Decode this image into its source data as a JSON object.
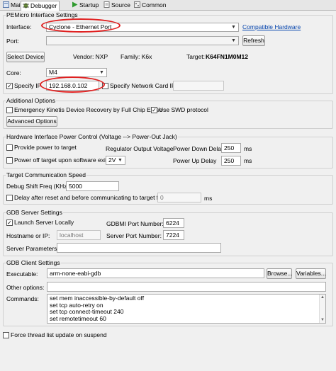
{
  "tabs": [
    {
      "label": "Main",
      "icon": "main-tab-icon"
    },
    {
      "label": "Debugger",
      "icon": "debugger-tab-icon"
    },
    {
      "label": "Startup",
      "icon": "startup-tab-icon"
    },
    {
      "label": "Source",
      "icon": "source-tab-icon"
    },
    {
      "label": "Common",
      "icon": "common-tab-icon"
    }
  ],
  "pemicro": {
    "title": "PEMicro Interface Settings",
    "interface_label": "Interface:",
    "interface_value": "Cyclone - Ethernet Port",
    "compatible_hardware": "Compatible Hardware",
    "port_label": "Port:",
    "port_value": "",
    "refresh": "Refresh",
    "select_device": "Select Device",
    "vendor": "Vendor: NXP",
    "family": "Family: K6x",
    "target_label": "Target:",
    "target_value": "K64FN1M0M12",
    "core_label": "Core:",
    "core_value": "M4",
    "specify_ip_label": "Specify IP",
    "specify_ip_checked": true,
    "ip_value": "192.168.0.102",
    "specify_nic_label": "Specify Network Card IP",
    "specify_nic_checked": false,
    "nic_value": ""
  },
  "additional": {
    "title": "Additional Options",
    "emergency_label": "Emergency Kinetis Device Recovery by Full Chip Erase",
    "emergency_checked": false,
    "swd_label": "Use SWD protocol",
    "swd_checked": true,
    "advanced_button": "Advanced Options"
  },
  "power": {
    "title": "Hardware Interface Power Control (Voltage --> Power-Out Jack)",
    "provide_label": "Provide power to target",
    "provide_checked": false,
    "regulator_label": "Regulator Output Voltage",
    "down_label": "Power Down Delay",
    "down_value": "250",
    "down_unit": "ms",
    "poweroff_label": "Power off target upon software exit",
    "poweroff_checked": false,
    "voltage_value": "2V",
    "up_label": "Power Up Delay",
    "up_value": "250",
    "up_unit": "ms"
  },
  "speed": {
    "title": "Target Communication Speed",
    "shift_label": "Debug Shift Freq (KHz)",
    "shift_value": "5000",
    "delay_label": "Delay after reset and before communicating to target for",
    "delay_checked": false,
    "delay_value": "0",
    "delay_unit": "ms"
  },
  "gdbserver": {
    "title": "GDB Server Settings",
    "launch_label": "Launch Server Locally",
    "launch_checked": true,
    "gdbmi_label": "GDBMI Port Number:",
    "gdbmi_value": "6224",
    "host_label": "Hostname or IP:",
    "host_value": "localhost",
    "server_port_label": "Server Port Number:",
    "server_port_value": "7224",
    "params_label": "Server Parameters:",
    "params_value": ""
  },
  "gdbclient": {
    "title": "GDB Client Settings",
    "exe_label": "Executable:",
    "exe_value": "arm-none-eabi-gdb",
    "browse": "Browse...",
    "variables": "Variables...",
    "other_label": "Other options:",
    "other_value": "",
    "commands_label": "Commands:",
    "commands": [
      "set mem inaccessible-by-default off",
      "set tcp auto-retry on",
      "set tcp connect-timeout 240",
      "set remotetimeout 60"
    ]
  },
  "footer": {
    "force_label": "Force thread list update on suspend",
    "force_checked": false
  },
  "colors": {
    "highlight_ring": "#e02020",
    "link": "#0645ad"
  }
}
